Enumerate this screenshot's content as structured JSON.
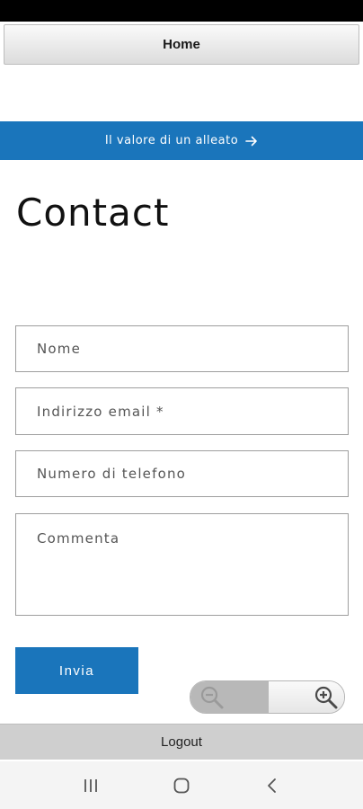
{
  "header": {
    "home_label": "Home"
  },
  "banner": {
    "text": "Il valore di un alleato",
    "icon": "arrow-right-icon"
  },
  "page": {
    "title": "Contact"
  },
  "form": {
    "name_placeholder": "Nome",
    "email_placeholder": "Indirizzo email *",
    "phone_placeholder": "Numero di telefono",
    "comment_placeholder": "Commenta",
    "submit_label": "Invia"
  },
  "zoom": {
    "out_icon": "zoom-out-icon",
    "in_icon": "zoom-in-icon"
  },
  "footer": {
    "logout_label": "Logout"
  },
  "navigation": {
    "recents_icon": "recents-icon",
    "home_icon": "home-icon",
    "back_icon": "back-icon"
  },
  "colors": {
    "accent": "#1a75bb",
    "status_bar": "#000000",
    "logout_bar": "#cfcfcf"
  }
}
